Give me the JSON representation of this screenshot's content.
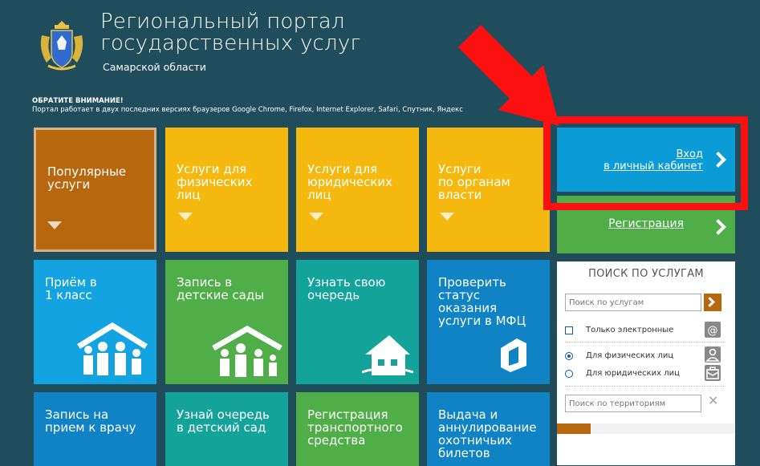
{
  "header": {
    "title_line1": "Региональный портал",
    "title_line2": "государственных услуг",
    "subtitle": "Самарской области"
  },
  "notice": {
    "title": "ОБРАТИТЕ ВНИМАНИЕ!",
    "text": "Портал работает в двух последних версиях браузеров Google Chrome, Firefox, Internet Explorer, Safari, Спутник, Яндекс"
  },
  "tiles_top": [
    {
      "label": "Популярные\nуслуги",
      "color": "#b7680f"
    },
    {
      "label": "Услуги для\nфизических\nлиц",
      "color": "#f5b80f"
    },
    {
      "label": "Услуги для\nюридических\nлиц",
      "color": "#f5b80f"
    },
    {
      "label": "Услуги\nпо органам\nвласти",
      "color": "#f5b80f"
    }
  ],
  "tiles_mid": [
    {
      "label": "Приём в\n1 класс",
      "color": "#12a3e0",
      "icon": "family-house-icon"
    },
    {
      "label": "Запись в\nдетские сады",
      "color": "#4fae47",
      "icon": "family-house-icon"
    },
    {
      "label": "Узнать свою\nочередь",
      "color": "#14a39a",
      "icon": "house-icon"
    },
    {
      "label": "Проверить\nстатус оказания\nуслуги в МФЦ",
      "color": "#0f83c4",
      "icon": "mfc-logo-icon"
    }
  ],
  "tiles_bottom": [
    {
      "label": "Запись на\nприем к врачу",
      "color": "#0f83c4"
    },
    {
      "label": "Узнай очередь\nв детский сад",
      "color": "#14a39a"
    },
    {
      "label": "Регистрация\nтранспортного\nсредства",
      "color": "#4fae47"
    },
    {
      "label": "Выдача и\nаннулирование\nохотничьих\nбилетов",
      "color": "#0f83c4"
    }
  ],
  "login": {
    "line1": "Вход",
    "line2": "в личный кабинет"
  },
  "register": {
    "label": "Регистрация"
  },
  "search": {
    "title": "ПОИСК ПО УСЛУГАМ",
    "placeholder": "Поиск по услугам",
    "only_electronic": "Только электронные",
    "for_individuals": "Для физических лиц",
    "for_legal": "Для юридических лиц",
    "territory_placeholder": "Поиск по территориям",
    "progress": 0.19
  },
  "colors": {
    "accent_red": "#ff1010",
    "background": "#1f4d5c"
  }
}
